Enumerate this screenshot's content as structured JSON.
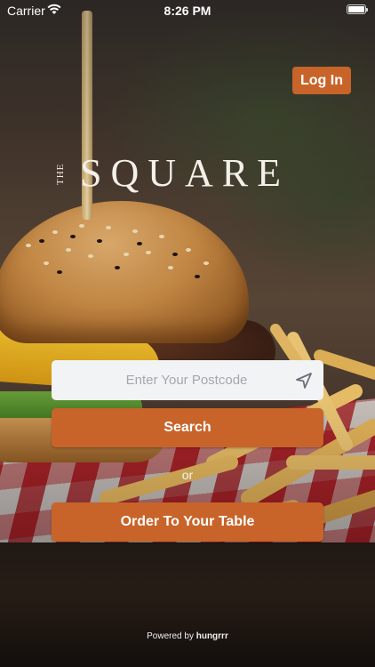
{
  "status_bar": {
    "carrier": "Carrier",
    "time": "8:26 PM",
    "wifi_icon": "wifi-icon",
    "battery_icon": "battery-icon"
  },
  "header": {
    "login_label": "Log In"
  },
  "logo": {
    "prefix": "THE",
    "name": "SQUARE"
  },
  "search": {
    "placeholder": "Enter Your Postcode",
    "value": "",
    "location_icon": "location-arrow-icon",
    "button_label": "Search"
  },
  "divider_text": "or",
  "order_table": {
    "label": "Order To Your Table"
  },
  "footer": {
    "powered_prefix": "Powered by ",
    "powered_brand": "hungrrr"
  },
  "colors": {
    "accent": "#c8642a",
    "input_bg": "#f2f3f5",
    "text_light": "#ffffff"
  }
}
